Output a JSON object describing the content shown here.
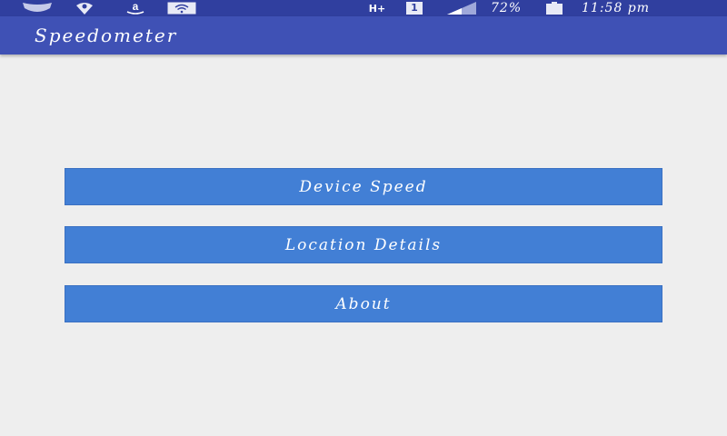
{
  "status_bar": {
    "icons": [
      "shield-icon",
      "location-pin-icon",
      "amazon-icon",
      "wifi-card-icon",
      "hplus-network-icon",
      "sim-1-icon",
      "signal-icon",
      "battery-icon"
    ],
    "network_label": "H+",
    "sim_label": "1",
    "battery_percent": "72%",
    "time": "11:58 pm"
  },
  "app_bar": {
    "title": "Speedometer"
  },
  "menu": {
    "device_speed": "Device Speed",
    "location_details": "Location Details",
    "about": "About"
  },
  "colors": {
    "status_bar": "#303f9f",
    "app_bar": "#3f51b5",
    "button": "#427fd5",
    "background": "#eeeeee"
  }
}
